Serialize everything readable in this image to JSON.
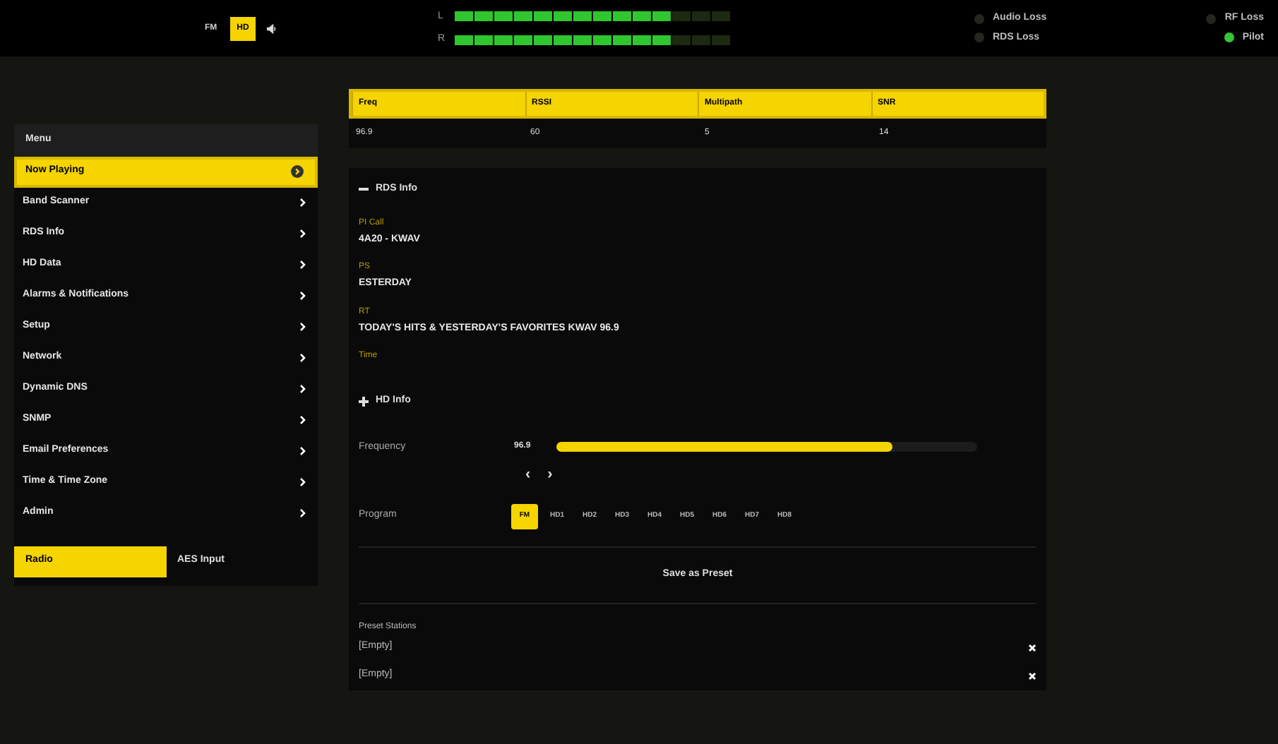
{
  "top_bar": {
    "source_buttons": [
      {
        "label": "FM",
        "selected": false
      },
      {
        "label": "HD",
        "selected": true
      }
    ],
    "meters": [
      {
        "channel": "L",
        "level": 0.78
      },
      {
        "channel": "R",
        "level": 0.78
      }
    ],
    "alarms": [
      {
        "label": "Audio Loss",
        "active": false
      },
      {
        "label": "RDS Loss",
        "active": false
      },
      {
        "label": "RF Loss",
        "active": false
      },
      {
        "label": "Pilot",
        "active": true
      }
    ]
  },
  "sidebar": {
    "title": "Menu",
    "items": [
      {
        "label": "Now Playing",
        "selected": true
      },
      {
        "label": "Band Scanner",
        "selected": false
      },
      {
        "label": "RDS Info",
        "selected": false
      },
      {
        "label": "HD Data",
        "selected": false
      },
      {
        "label": "Alarms & Notifications",
        "selected": false
      },
      {
        "label": "Setup",
        "selected": false
      },
      {
        "label": "Network",
        "selected": false
      },
      {
        "label": "Dynamic DNS",
        "selected": false
      },
      {
        "label": "SNMP",
        "selected": false
      },
      {
        "label": "Email Preferences",
        "selected": false
      },
      {
        "label": "Time & Time Zone",
        "selected": false
      },
      {
        "label": "Admin",
        "selected": false
      }
    ],
    "tabs": [
      {
        "label": "Radio",
        "selected": true
      },
      {
        "label": "AES Input",
        "selected": false
      }
    ]
  },
  "table": {
    "columns": [
      "Freq",
      "RSSI",
      "Multipath",
      "SNR"
    ],
    "rows": [
      [
        "96.9",
        "60",
        "5",
        "14"
      ]
    ]
  },
  "rds_info": {
    "title": "RDS Info",
    "expanded": true,
    "fields": [
      {
        "label": "PI Call",
        "value": "4A20 - KWAV"
      },
      {
        "label": "PS",
        "value": "ESTERDAY"
      },
      {
        "label": "RT",
        "value": "TODAY'S HITS & YESTERDAY'S FAVORITES KWAV 96.9"
      },
      {
        "label": "Time"
      }
    ]
  },
  "hd_info": {
    "title": "HD Info",
    "expanded": false
  },
  "frequency": {
    "label": "Frequency",
    "value": "96.9",
    "level": 0.8,
    "prev": "‹",
    "next": "›"
  },
  "program": {
    "label": "Program",
    "options": [
      {
        "label": "FM",
        "selected": true
      },
      {
        "label": "HD1",
        "selected": false
      },
      {
        "label": "HD2",
        "selected": false
      },
      {
        "label": "HD3",
        "selected": false
      },
      {
        "label": "HD4",
        "selected": false
      },
      {
        "label": "HD5",
        "selected": false
      },
      {
        "label": "HD6",
        "selected": false
      },
      {
        "label": "HD7",
        "selected": false
      },
      {
        "label": "HD8",
        "selected": false
      }
    ]
  },
  "save_button": "Save as Preset",
  "presets": {
    "title": "Preset Stations",
    "items": [
      "[Empty]",
      "[Empty]"
    ]
  }
}
